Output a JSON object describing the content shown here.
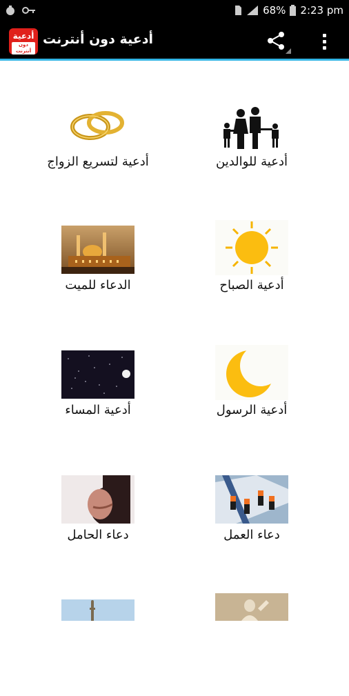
{
  "status_bar": {
    "battery": "68%",
    "time": "2:23 pm"
  },
  "app_bar": {
    "logo_text": "أدعية",
    "logo_sub": "دون أنترنت",
    "title": "أدعية دون أنترنت"
  },
  "items": [
    {
      "label": "أدعية للوالدين",
      "icon": "family-image"
    },
    {
      "label": "أدعية لتسريع الزواج",
      "icon": "wedding-rings-image"
    },
    {
      "label": "أدعية الصباح",
      "icon": "sun-image"
    },
    {
      "label": "الدعاء للميت",
      "icon": "mosque-image"
    },
    {
      "label": "أدعية الرسول",
      "icon": "crescent-moon-image"
    },
    {
      "label": "أدعية المساء",
      "icon": "night-sky-image"
    },
    {
      "label": "دعاء العمل",
      "icon": "workers-image"
    },
    {
      "label": "دعاء الحامل",
      "icon": "pregnant-woman-image"
    },
    {
      "label": "",
      "icon": "statue-image"
    },
    {
      "label": "",
      "icon": "minaret-image"
    }
  ],
  "colors": {
    "app_bar": "#000000",
    "accent_line": "#33b5e5",
    "logo_red": "#e0201b"
  }
}
